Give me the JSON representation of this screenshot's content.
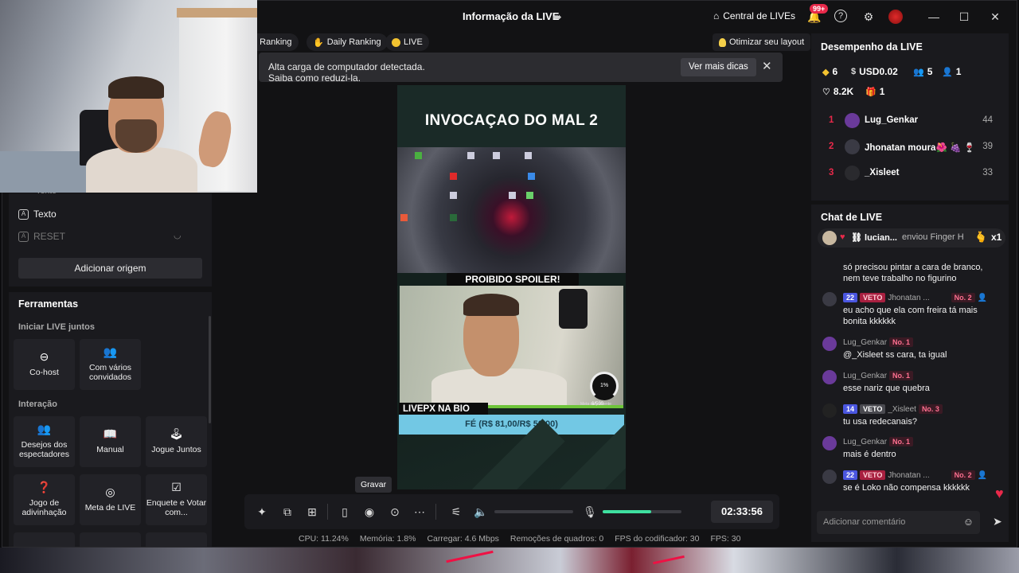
{
  "titlebar": {
    "title": "Informação da LIVE",
    "central_label": "Central de LIVEs",
    "notifications_badge": "99+"
  },
  "tabs": [
    {
      "label": "g Ranking"
    },
    {
      "label": "Daily Ranking"
    },
    {
      "label": "LIVE"
    }
  ],
  "optimize_label": "Otimizar seu layout",
  "banner": {
    "message": "Alta carga de computador detectada. Saiba como reduzi-la.",
    "button": "Ver mais dicas"
  },
  "sources": {
    "partial": "Texto",
    "items": [
      "Texto",
      "RESET"
    ],
    "add_button": "Adicionar origem"
  },
  "tools": {
    "heading": "Ferramentas",
    "section1": "Iniciar LIVE juntos",
    "section2": "Interação",
    "cohost": "Co-host",
    "multi": "Com vários convidados",
    "wishes": "Desejos dos espectadores",
    "manual": "Manual",
    "play": "Jogue Juntos",
    "guess": "Jogo de adivinhação",
    "goal": "Meta de LIVE",
    "poll": "Enquete e Votar com..."
  },
  "stage": {
    "title": "INVOCAÇAO DO MAL 2",
    "spoiler": "PROIBIDO SPOILER!",
    "livepx": "LIVEPX NA BIO",
    "fe": "FÉ (R$ 81,00/R$ 50,00)",
    "gauge": "1%",
    "gauge_sub": "6/500",
    "meta_caption": "Meta de presente"
  },
  "controls": {
    "tooltip": "Gravar",
    "timer": "02:33:56",
    "volume_level": 0,
    "mic_level": 0.62
  },
  "status": {
    "cpu": "CPU:  11.24%",
    "mem": "Memória:  1.8%",
    "upload": "Carregar:  4.6 Mbps",
    "dropped": "Remoções de quadros:  0",
    "enc_fps": "FPS do codificador:  30",
    "fps": "FPS:  30"
  },
  "performance": {
    "heading": "Desempenho da LIVE",
    "diamonds": "6",
    "usd": "USD0.02",
    "viewers": "5",
    "new_followers": "1",
    "likes": "8.2K",
    "gifts": "1",
    "ranking": [
      {
        "rank": "1",
        "name": "Lug_Genkar",
        "score": "44"
      },
      {
        "rank": "2",
        "name": "Jhonatan moura🌺 🍇  🍷 🍸",
        "score": "39"
      },
      {
        "rank": "3",
        "name": "_Xisleet",
        "score": "33"
      }
    ]
  },
  "chat": {
    "heading": "Chat de LIVE",
    "gift": {
      "name": "⛓ lucian...",
      "text": "enviou Finger H",
      "count": "x1"
    },
    "messages": [
      {
        "user": "",
        "text": "só precisou pintar a cara de branco, nem teve trabalho no figurino"
      },
      {
        "user": "Jhonatan ...",
        "level": "22",
        "fan": "VETO",
        "rank": "No. 2",
        "text": "eu acho que ela com freira tá mais bonita kkkkkk"
      },
      {
        "user": "Lug_Genkar",
        "rank": "No. 1",
        "text": "@_Xisleet ss cara, ta igual"
      },
      {
        "user": "Lug_Genkar",
        "rank": "No. 1",
        "text": "esse nariz que quebra"
      },
      {
        "user": "_Xisleet",
        "level": "14",
        "fan": "VETO",
        "rank": "No. 3",
        "text": "tu usa redecanais?"
      },
      {
        "user": "Lug_Genkar",
        "rank": "No. 1",
        "text": "mais é dentro"
      },
      {
        "user": "Jhonatan ...",
        "level": "22",
        "fan": "VETO",
        "rank": "No. 2",
        "text": "se é Loko não compensa kkkkkk"
      }
    ],
    "input_placeholder": "Adicionar comentário"
  }
}
